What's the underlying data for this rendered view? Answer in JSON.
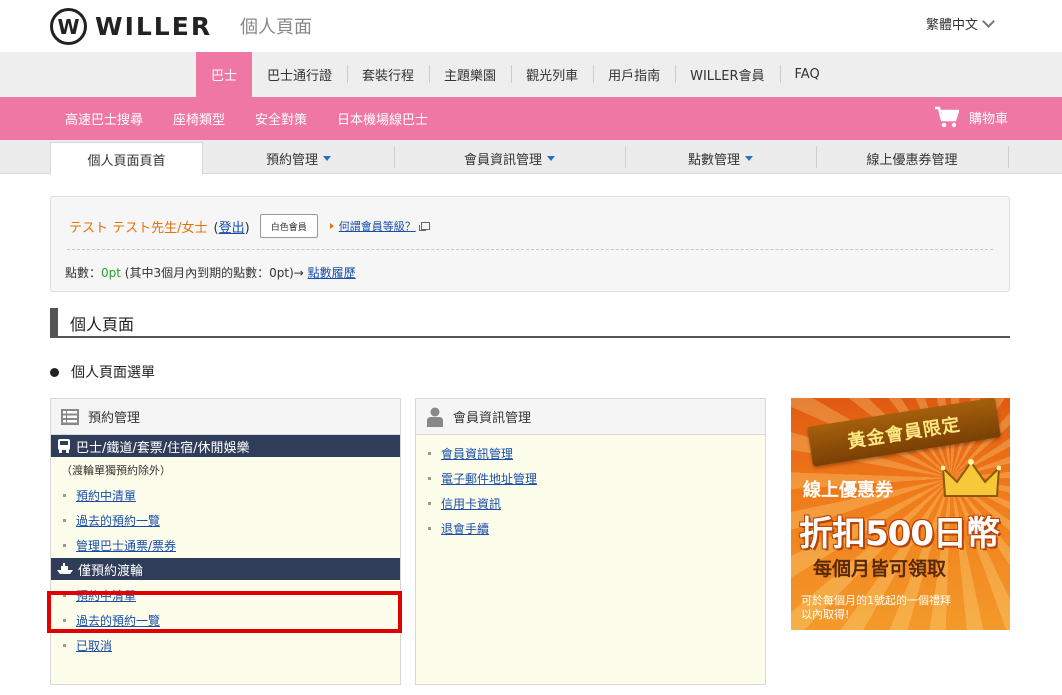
{
  "header": {
    "logo_mark": "W",
    "logo_text": "WILLER",
    "page_heading": "個人頁面",
    "language": "繁體中文"
  },
  "main_nav": {
    "items": [
      {
        "label": "巴士",
        "active": true
      },
      {
        "label": "巴士通行證"
      },
      {
        "label": "套裝行程"
      },
      {
        "label": "主題樂園"
      },
      {
        "label": "觀光列車"
      },
      {
        "label": "用戶指南"
      },
      {
        "label": "WILLER會員"
      },
      {
        "label": "FAQ"
      }
    ]
  },
  "sub_nav": {
    "items": [
      {
        "label": "高速巴士搜尋"
      },
      {
        "label": "座椅類型"
      },
      {
        "label": "安全對策"
      },
      {
        "label": "日本機場線巴士"
      }
    ],
    "cart_label": "購物車"
  },
  "tabs": [
    {
      "label": "個人頁面頁首"
    },
    {
      "label": "預約管理"
    },
    {
      "label": "會員資訊管理"
    },
    {
      "label": "點數管理"
    },
    {
      "label": "線上優惠券管理"
    }
  ],
  "member": {
    "name": "テスト テスト先生/女士",
    "logout_open": "(",
    "logout_label": "登出",
    "logout_close": ")",
    "badge": "白色會員",
    "help_link": "何謂會員等級？",
    "points_prefix": "點數：",
    "points_value": "0pt",
    "points_suffix": " (其中3個月內到期的點數：0pt)→ ",
    "history_link": "點數履歷"
  },
  "section_title": "個人頁面",
  "menu_title": "個人頁面選單",
  "reservation_panel": {
    "title": "預約管理",
    "band1": "巴士/鐵道/套票/住宿/休閒娛樂",
    "note": "（渡輪單獨預約除外）",
    "links1": [
      "預約中清單",
      "過去的預約一覽",
      "管理巴士通票/票券"
    ],
    "band2": "僅預約渡輪",
    "links2": [
      "預約中清單",
      "過去的預約一覽",
      "已取消"
    ]
  },
  "member_panel": {
    "title": "會員資訊管理",
    "links": [
      "會員資訊管理",
      "電子郵件地址管理",
      "信用卡資訊",
      "退會手續"
    ]
  },
  "promo": {
    "ribbon": "黃金會員限定",
    "line2": "線上優惠券",
    "line3": "折扣500日幣",
    "line4": "每個月皆可領取",
    "line5a": "可於每個月的1號起的一個禮拜",
    "line5b": "以內取得!"
  },
  "colors": {
    "pink": "#ee78a3",
    "navy_band": "#2f3d5a",
    "link": "#1a4ea8",
    "name_orange": "#e2730b",
    "points_green": "#27a02b",
    "highlight_red": "#e00000"
  }
}
